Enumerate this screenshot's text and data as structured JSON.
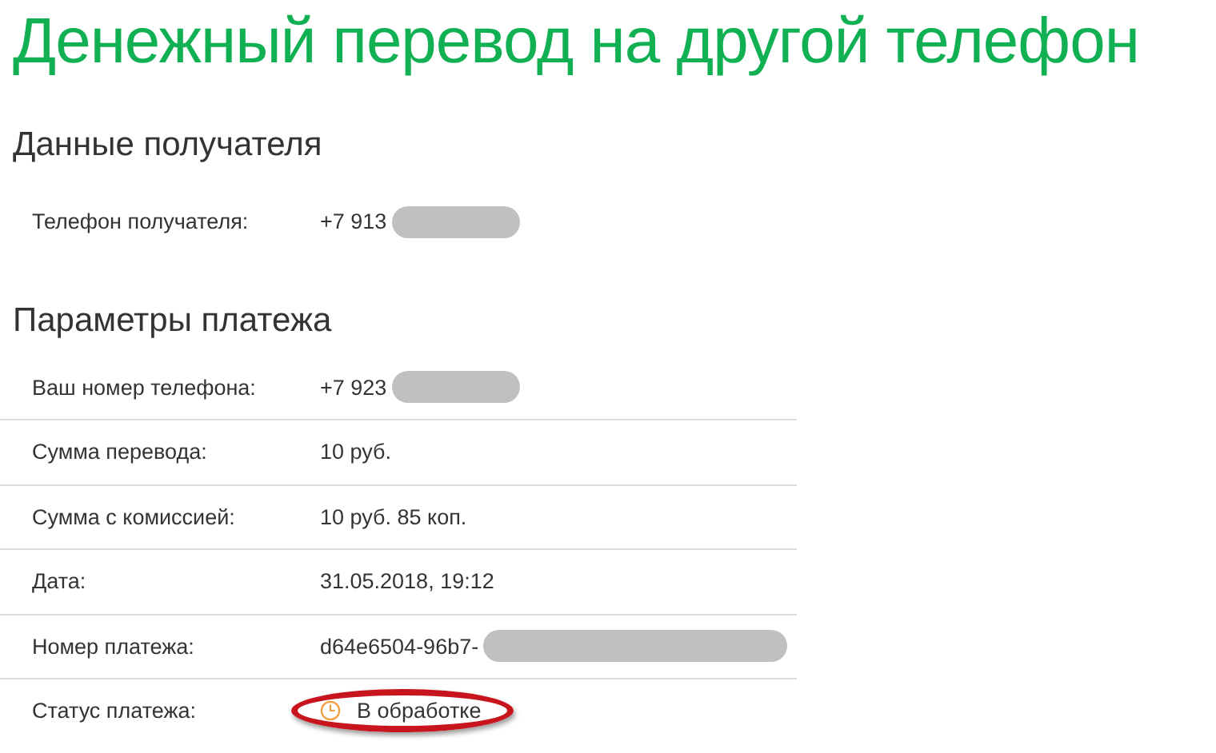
{
  "title": "Денежный перевод на другой телефон",
  "sections": [
    {
      "heading": "Данные получателя",
      "rows": [
        {
          "label": "Телефон получателя:",
          "value": "+7 913",
          "kind": "text",
          "redacted": true
        }
      ]
    },
    {
      "heading": "Параметры платежа",
      "rows": [
        {
          "label": "Ваш номер телефона:",
          "value": "+7 923",
          "kind": "text",
          "redacted": true
        },
        {
          "label": "Сумма перевода:",
          "value": "10 руб.",
          "kind": "text",
          "redacted": false
        },
        {
          "label": "Сумма с комиссией:",
          "value": "10 руб. 85 коп.",
          "kind": "text",
          "redacted": false
        },
        {
          "label": "Дата:",
          "value": "31.05.2018, 19:12",
          "kind": "text",
          "redacted": false
        },
        {
          "label": "Номер платежа:",
          "value": "d64e6504-96b7-",
          "kind": "text",
          "redacted": true
        },
        {
          "label": "Статус платежа:",
          "value": "В обработке",
          "kind": "status",
          "redacted": false,
          "highlighted": true
        }
      ]
    }
  ]
}
